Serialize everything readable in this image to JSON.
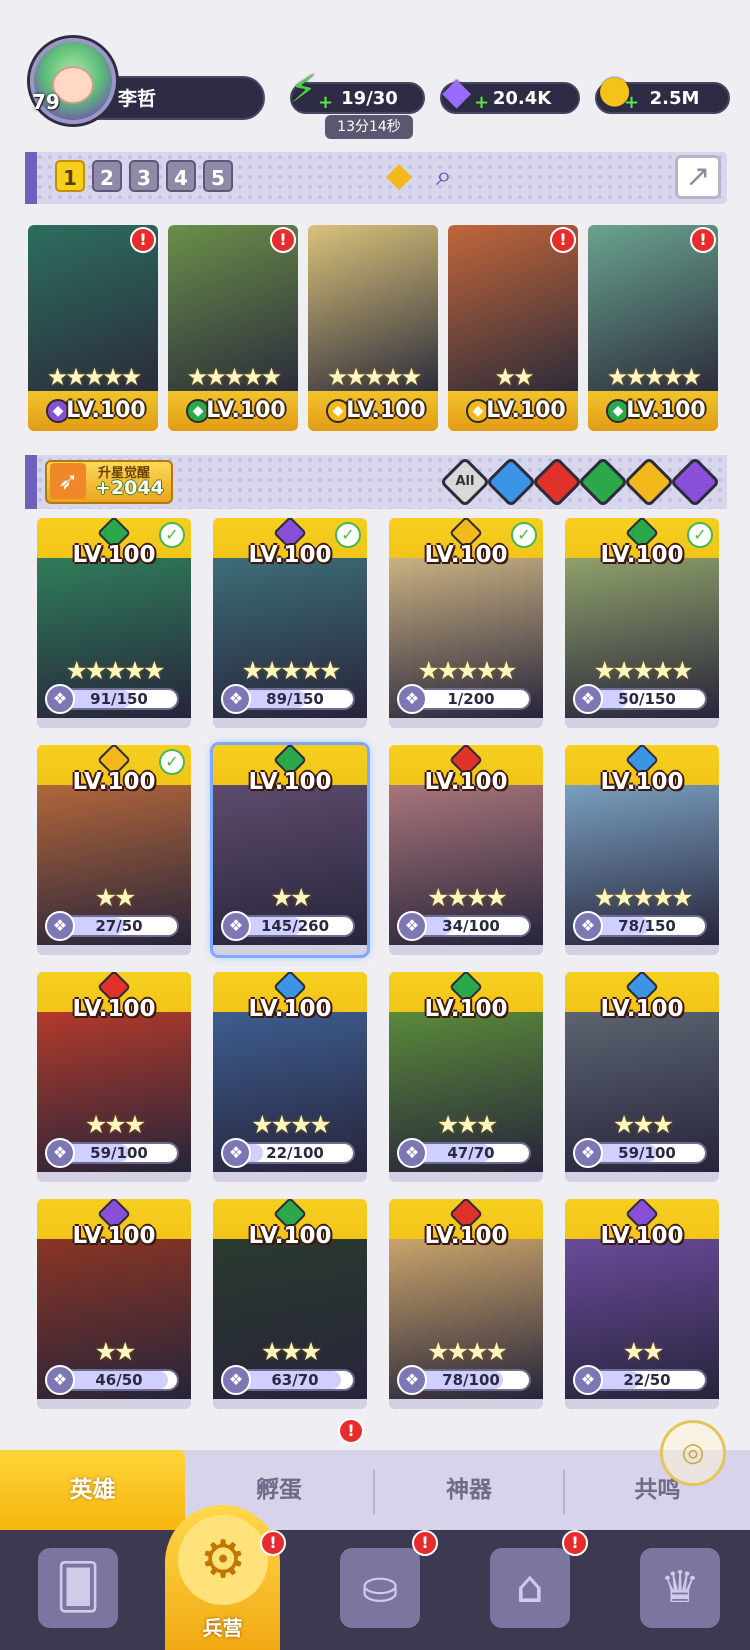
{
  "player": {
    "name": "李哲",
    "level": "79"
  },
  "resources": {
    "energy": {
      "value": "19/30",
      "timer": "13分14秒"
    },
    "gems": {
      "value": "20.4K"
    },
    "coins": {
      "value": "2.5M"
    }
  },
  "team_tabs": [
    "1",
    "2",
    "3",
    "4",
    "5"
  ],
  "team_tab_active": "1",
  "team_cards": [
    {
      "level": "LV.100",
      "stars": "★★★★★",
      "element": "dark",
      "alert": true
    },
    {
      "level": "LV.100",
      "stars": "★★★★★",
      "element": "wind",
      "alert": true
    },
    {
      "level": "LV.100",
      "stars": "★★★★★",
      "element": "light",
      "alert": false
    },
    {
      "level": "LV.100",
      "stars": "★★",
      "element": "light",
      "alert": true
    },
    {
      "level": "LV.100",
      "stars": "★★★★★",
      "element": "wind",
      "alert": true
    }
  ],
  "awaken": {
    "title": "升星觉醒",
    "count": "+2044"
  },
  "filters": [
    {
      "label": "All",
      "color": "#d9d9d9"
    },
    {
      "label": "",
      "color": "#3b94e6"
    },
    {
      "label": "",
      "color": "#e0312a"
    },
    {
      "label": "",
      "color": "#2aa84a"
    },
    {
      "label": "",
      "color": "#f2b81c"
    },
    {
      "label": "",
      "color": "#8a4fd8"
    }
  ],
  "heroes": [
    {
      "level": "LV.100",
      "stars": "★★★★★",
      "progress": "91/150",
      "element_color": "#2aa84a",
      "check": true,
      "art": "#2f7d5a"
    },
    {
      "level": "LV.100",
      "stars": "★★★★★",
      "progress": "89/150",
      "element_color": "#8a4fd8",
      "check": true,
      "art": "#3d6d78"
    },
    {
      "level": "LV.100",
      "stars": "★★★★★",
      "progress": "1/200",
      "element_color": "#f2b81c",
      "check": true,
      "art": "#c9b182"
    },
    {
      "level": "LV.100",
      "stars": "★★★★★",
      "progress": "50/150",
      "element_color": "#2aa84a",
      "check": true,
      "art": "#8fa16a"
    },
    {
      "level": "LV.100",
      "stars": "★★",
      "progress": "27/50",
      "element_color": "#f2b81c",
      "check": true,
      "art": "#b2663a"
    },
    {
      "level": "LV.100",
      "stars": "★★",
      "progress": "145/260",
      "element_color": "#2aa84a",
      "check": false,
      "art": "#5d4b6d",
      "selected": true
    },
    {
      "level": "LV.100",
      "stars": "★★★★",
      "progress": "34/100",
      "element_color": "#e0312a",
      "check": false,
      "art": "#a8757a"
    },
    {
      "level": "LV.100",
      "stars": "★★★★★",
      "progress": "78/150",
      "element_color": "#3b94e6",
      "check": false,
      "art": "#7a9fbf"
    },
    {
      "level": "LV.100",
      "stars": "★★★",
      "progress": "59/100",
      "element_color": "#e0312a",
      "check": false,
      "art": "#b23a2a"
    },
    {
      "level": "LV.100",
      "stars": "★★★★",
      "progress": "22/100",
      "element_color": "#3b94e6",
      "check": false,
      "art": "#3d5d8f"
    },
    {
      "level": "LV.100",
      "stars": "★★★",
      "progress": "47/70",
      "element_color": "#2aa84a",
      "check": false,
      "art": "#5a8a3a"
    },
    {
      "level": "LV.100",
      "stars": "★★★",
      "progress": "59/100",
      "element_color": "#3b94e6",
      "check": false,
      "art": "#5b6470"
    },
    {
      "level": "LV.100",
      "stars": "★★",
      "progress": "46/50",
      "element_color": "#8a4fd8",
      "check": false,
      "art": "#8a3524"
    },
    {
      "level": "LV.100",
      "stars": "★★★",
      "progress": "63/70",
      "element_color": "#2aa84a",
      "check": false,
      "art": "#2b3a2e"
    },
    {
      "level": "LV.100",
      "stars": "★★★★",
      "progress": "78/100",
      "element_color": "#e0312a",
      "check": false,
      "art": "#c9a46a"
    },
    {
      "level": "LV.100",
      "stars": "★★",
      "progress": "22/50",
      "element_color": "#8a4fd8",
      "check": false,
      "art": "#6a4a9a"
    }
  ],
  "subtabs": [
    "英雄",
    "孵蛋",
    "神器",
    "共鸣"
  ],
  "nav": {
    "active_label": "兵营"
  }
}
